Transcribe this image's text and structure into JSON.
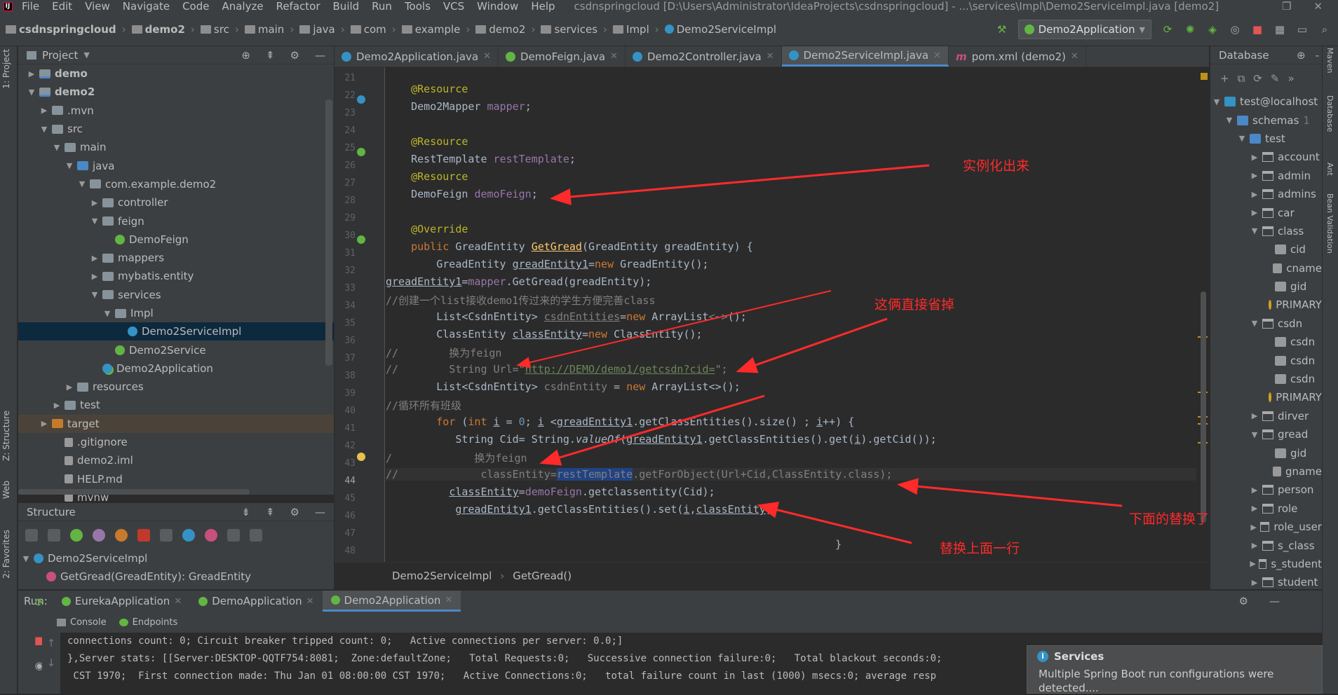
{
  "menubar": {
    "items": [
      "File",
      "Edit",
      "View",
      "Navigate",
      "Code",
      "Analyze",
      "Refactor",
      "Build",
      "Run",
      "Tools",
      "VCS",
      "Window",
      "Help"
    ],
    "window_title": "csdnspringcloud [D:\\Users\\Administrator\\IdeaProjects\\csdnspringcloud] - ...\\services\\Impl\\Demo2ServiceImpl.java [demo2]"
  },
  "breadcrumbs": [
    "csdnspringcloud",
    "demo2",
    "src",
    "main",
    "java",
    "com",
    "example",
    "demo2",
    "services",
    "Impl",
    "Demo2ServiceImpl"
  ],
  "run_config": "Demo2Application",
  "project_panel": {
    "title": "Project",
    "tree": [
      {
        "label": "demo",
        "indent": 0,
        "arrow": "right",
        "icon": "mod",
        "bold": true
      },
      {
        "label": "demo2",
        "indent": 0,
        "arrow": "down",
        "icon": "mod",
        "bold": true
      },
      {
        "label": ".mvn",
        "indent": 1,
        "arrow": "right",
        "icon": "folder"
      },
      {
        "label": "src",
        "indent": 1,
        "arrow": "down",
        "icon": "folder"
      },
      {
        "label": "main",
        "indent": 2,
        "arrow": "down",
        "icon": "folder"
      },
      {
        "label": "java",
        "indent": 3,
        "arrow": "down",
        "icon": "src"
      },
      {
        "label": "com.example.demo2",
        "indent": 4,
        "arrow": "down",
        "icon": "pkg"
      },
      {
        "label": "controller",
        "indent": 5,
        "arrow": "right",
        "icon": "pkg"
      },
      {
        "label": "feign",
        "indent": 5,
        "arrow": "down",
        "icon": "pkg"
      },
      {
        "label": "DemoFeign",
        "indent": 6,
        "arrow": "",
        "icon": "itf"
      },
      {
        "label": "mappers",
        "indent": 5,
        "arrow": "right",
        "icon": "pkg"
      },
      {
        "label": "mybatis.entity",
        "indent": 5,
        "arrow": "right",
        "icon": "pkg"
      },
      {
        "label": "services",
        "indent": 5,
        "arrow": "down",
        "icon": "pkg"
      },
      {
        "label": "Impl",
        "indent": 6,
        "arrow": "down",
        "icon": "pkg"
      },
      {
        "label": "Demo2ServiceImpl",
        "indent": 7,
        "arrow": "",
        "icon": "cls",
        "selected": true
      },
      {
        "label": "Demo2Service",
        "indent": 6,
        "arrow": "",
        "icon": "itf"
      },
      {
        "label": "Demo2Application",
        "indent": 5,
        "arrow": "",
        "icon": "spring"
      },
      {
        "label": "resources",
        "indent": 3,
        "arrow": "right",
        "icon": "folder"
      },
      {
        "label": "test",
        "indent": 2,
        "arrow": "right",
        "icon": "folder"
      },
      {
        "label": "target",
        "indent": 1,
        "arrow": "right",
        "icon": "orange",
        "target": true
      },
      {
        "label": ".gitignore",
        "indent": 2,
        "arrow": "",
        "icon": "file"
      },
      {
        "label": "demo2.iml",
        "indent": 2,
        "arrow": "",
        "icon": "file"
      },
      {
        "label": "HELP.md",
        "indent": 2,
        "arrow": "",
        "icon": "file"
      },
      {
        "label": "mvnw",
        "indent": 2,
        "arrow": "",
        "icon": "file"
      }
    ]
  },
  "structure_panel": {
    "title": "Structure",
    "class_name": "Demo2ServiceImpl",
    "method": "GetGread(GreadEntity): GreadEntity"
  },
  "editor": {
    "tabs": [
      {
        "label": "Demo2Application.java",
        "icon": "spring"
      },
      {
        "label": "DemoFeign.java",
        "icon": "itf"
      },
      {
        "label": "Demo2Controller.java",
        "icon": "cls"
      },
      {
        "label": "Demo2ServiceImpl.java",
        "icon": "cls",
        "active": true
      },
      {
        "label": "pom.xml (demo2)",
        "icon": "m"
      }
    ],
    "line_numbers": [
      "21",
      "22",
      "23",
      "24",
      "25",
      "26",
      "27",
      "28",
      "29",
      "30",
      "31",
      "32",
      "33",
      "34",
      "35",
      "36",
      "37",
      "38",
      "39",
      "40",
      "41",
      "42",
      "43",
      "44",
      "45",
      "46",
      "47",
      "48"
    ],
    "current_line": "44",
    "breadcrumb": [
      "Demo2ServiceImpl",
      "GetGread()"
    ]
  },
  "annotations": {
    "a1": "实例化出来",
    "a2": "这俩直接省掉",
    "a3": "下面的替换了",
    "a4": "替换上面一行"
  },
  "database_panel": {
    "title": "Database",
    "tree": [
      {
        "label": "test@localhost",
        "indent": 0,
        "arrow": "down",
        "icon": "conn"
      },
      {
        "label": "schemas",
        "indent": 1,
        "arrow": "down",
        "icon": "folder",
        "count": "1"
      },
      {
        "label": "test",
        "indent": 2,
        "arrow": "down",
        "icon": "schema"
      },
      {
        "label": "account",
        "indent": 3,
        "arrow": "right",
        "icon": "table"
      },
      {
        "label": "admin",
        "indent": 3,
        "arrow": "right",
        "icon": "table"
      },
      {
        "label": "admins",
        "indent": 3,
        "arrow": "right",
        "icon": "table"
      },
      {
        "label": "car",
        "indent": 3,
        "arrow": "right",
        "icon": "table"
      },
      {
        "label": "class",
        "indent": 3,
        "arrow": "down",
        "icon": "table"
      },
      {
        "label": "cid",
        "indent": 4,
        "arrow": "",
        "icon": "col"
      },
      {
        "label": "cname",
        "indent": 4,
        "arrow": "",
        "icon": "col"
      },
      {
        "label": "gid",
        "indent": 4,
        "arrow": "",
        "icon": "col"
      },
      {
        "label": "PRIMARY",
        "indent": 4,
        "arrow": "",
        "icon": "key"
      },
      {
        "label": "csdn",
        "indent": 3,
        "arrow": "down",
        "icon": "table"
      },
      {
        "label": "csdn",
        "indent": 4,
        "arrow": "",
        "icon": "col"
      },
      {
        "label": "csdn",
        "indent": 4,
        "arrow": "",
        "icon": "col"
      },
      {
        "label": "csdn",
        "indent": 4,
        "arrow": "",
        "icon": "col"
      },
      {
        "label": "PRIMARY",
        "indent": 4,
        "arrow": "",
        "icon": "key"
      },
      {
        "label": "dirver",
        "indent": 3,
        "arrow": "right",
        "icon": "table"
      },
      {
        "label": "gread",
        "indent": 3,
        "arrow": "down",
        "icon": "table"
      },
      {
        "label": "gid",
        "indent": 4,
        "arrow": "",
        "icon": "col"
      },
      {
        "label": "gname",
        "indent": 4,
        "arrow": "",
        "icon": "col"
      },
      {
        "label": "person",
        "indent": 3,
        "arrow": "right",
        "icon": "table"
      },
      {
        "label": "role",
        "indent": 3,
        "arrow": "right",
        "icon": "table"
      },
      {
        "label": "role_user",
        "indent": 3,
        "arrow": "right",
        "icon": "table"
      },
      {
        "label": "s_class",
        "indent": 3,
        "arrow": "right",
        "icon": "table"
      },
      {
        "label": "s_student",
        "indent": 3,
        "arrow": "right",
        "icon": "table"
      },
      {
        "label": "student",
        "indent": 3,
        "arrow": "right",
        "icon": "table"
      }
    ]
  },
  "left_strip": {
    "project": "1: Project",
    "structure": "Z: Structure",
    "web": "Web",
    "favorites": "2: Favorites"
  },
  "right_strip": {
    "maven": "Maven",
    "database": "Database",
    "ant": "Ant",
    "bean": "Bean Validation"
  },
  "run_panel": {
    "label": "Run:",
    "tabs": [
      {
        "label": "EurekaApplication"
      },
      {
        "label": "DemoApplication"
      },
      {
        "label": "Demo2Application",
        "active": true
      }
    ],
    "subtabs": [
      "Console",
      "Endpoints"
    ],
    "console_lines": [
      "connections count: 0; Circuit breaker tripped count: 0;   Active connections per server: 0.0;]",
      "},Server stats: [[Server:DESKTOP-QQTF754:8081;  Zone:defaultZone;   Total Requests:0;   Successive connection failure:0;   Total blackout seconds:0;",
      " CST 1970;  First connection made: Thu Jan 01 08:00:00 CST 1970;   Active Connections:0;   total failure count in last (1000) msecs:0; average resp"
    ]
  },
  "notification": {
    "title": "Services",
    "body": "Multiple Spring Boot run configurations were detected...."
  },
  "colors": {
    "accent": "#4a88c7",
    "annotation_red": "#ff2a2a",
    "selection": "#0d293e"
  }
}
